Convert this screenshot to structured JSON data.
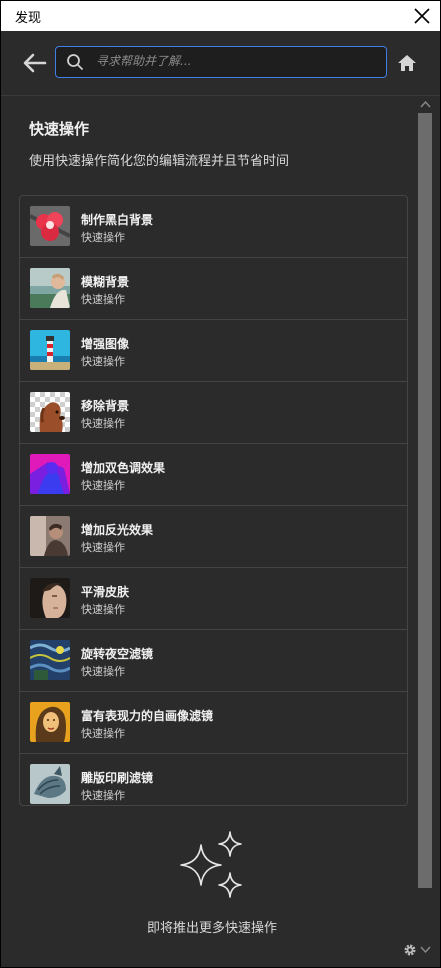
{
  "window": {
    "title": "发现"
  },
  "search": {
    "placeholder": "寻求帮助并了解..."
  },
  "panel": {
    "heading": "快速操作",
    "description": "使用快速操作简化您的编辑流程并且节省时间",
    "coming_soon": "即将推出更多快速操作"
  },
  "actions": [
    {
      "title": "制作黑白背景",
      "subtitle": "快速操作"
    },
    {
      "title": "模糊背景",
      "subtitle": "快速操作"
    },
    {
      "title": "增强图像",
      "subtitle": "快速操作"
    },
    {
      "title": "移除背景",
      "subtitle": "快速操作"
    },
    {
      "title": "增加双色调效果",
      "subtitle": "快速操作"
    },
    {
      "title": "增加反光效果",
      "subtitle": "快速操作"
    },
    {
      "title": "平滑皮肤",
      "subtitle": "快速操作"
    },
    {
      "title": "旋转夜空滤镜",
      "subtitle": "快速操作"
    },
    {
      "title": "富有表现力的自画像滤镜",
      "subtitle": "快速操作"
    },
    {
      "title": "雕版印刷滤镜",
      "subtitle": "快速操作"
    }
  ],
  "colors": {
    "accent": "#3f7fe5",
    "panel_bg": "#2b2b2b",
    "border": "#444444"
  },
  "icons": [
    "close-icon",
    "back-arrow-icon",
    "search-icon",
    "home-icon",
    "sparkles-icon",
    "gear-icon"
  ]
}
